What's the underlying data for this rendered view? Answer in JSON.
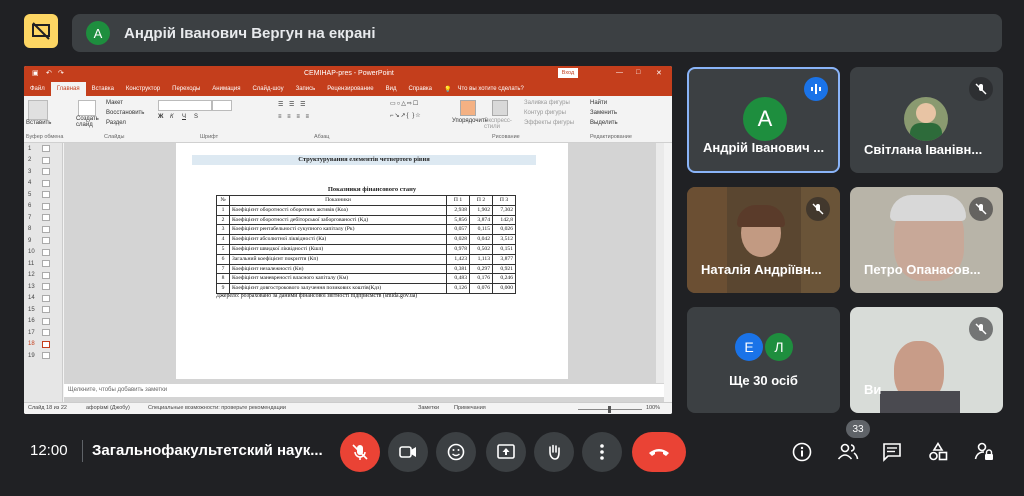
{
  "banner": {
    "presenter_initial": "А",
    "presenter_text": "Андрій Іванович Вергун на екрані"
  },
  "powerpoint": {
    "title": "СЕМІНАР-pres - PowerPoint",
    "login": "Вход",
    "tabs": [
      "Файл",
      "Главная",
      "Вставка",
      "Конструктор",
      "Переходы",
      "Анимация",
      "Слайд-шоу",
      "Запись",
      "Рецензирование",
      "Вид",
      "Справка"
    ],
    "tell_me": "Что вы хотите сделать?",
    "ribbon": {
      "paste": "Вставить",
      "create_slide": "Создать слайд",
      "layout": "Макет",
      "restore": "Восстановить",
      "section": "Раздел",
      "arrange": "Упорядочить",
      "quick_styles": "Экспресс-стили",
      "fill": "Заливка фигуры",
      "outline": "Контур фигуры",
      "effects": "Эффекты фигуры",
      "find": "Найти",
      "replace": "Заменить",
      "select": "Выделить",
      "group_clipboard": "Буфер обмена",
      "group_slides": "Слайды",
      "group_font": "Шрифт",
      "group_paragraph": "Абзац",
      "group_drawing": "Рисование",
      "group_editing": "Редактирование"
    },
    "thumb_numbers": [
      "1",
      "2",
      "3",
      "4",
      "5",
      "6",
      "7",
      "8",
      "9",
      "10",
      "11",
      "12",
      "13",
      "14",
      "15",
      "16",
      "17",
      "18",
      "19"
    ],
    "notes_placeholder": "Щелкните, чтобы добавить заметки",
    "status": {
      "slide": "Слайд 18 из 22",
      "author": "афорізмі (Джобу)",
      "accessibility": "Специальные возможности: проверьте рекомендации",
      "notes": "Заметки",
      "comments": "Примечания",
      "zoom": "100%"
    },
    "slide": {
      "heading": "Структурування елементів четвертого рівня",
      "table_title": "Показники фінансового стану",
      "headers": [
        "№",
        "Показники",
        "П 1",
        "П 2",
        "П 3"
      ],
      "rows": [
        [
          "1",
          "Коефіцієнт оборотності оборотних активів (Коа)",
          "2,938",
          "1,902",
          "7,302"
        ],
        [
          "2",
          "Коефіцієнт оборотності дебіторської заборгованості (Кд)",
          "5,856",
          "3,874",
          "142,8"
        ],
        [
          "3",
          "Коефіцієнт рентабельності сукупного капіталу (Рк)",
          "0,057",
          "0,115",
          "0,026"
        ],
        [
          "4",
          "Коефіцієнт абсолютної ліквідності (Ка)",
          "0,028",
          "0,042",
          "3,512"
        ],
        [
          "5",
          "Коефіцієнт швидкої ліквідності (Кшл)",
          "0,978",
          "0,502",
          "0,151"
        ],
        [
          "6",
          "Загальний коефіцієнт покриття (Кп)",
          "1,423",
          "1,113",
          "3,877"
        ],
        [
          "7",
          "Коефіцієнт незалежності (Кн)",
          "0,381",
          "0,297",
          "0,921"
        ],
        [
          "8",
          "Коефіцієнт маневреності власного капіталу (Км)",
          "0,483",
          "0,176",
          "0,246"
        ],
        [
          "9",
          "Коефіцієнт довгострокового залучення позикових коштів(Кдз)",
          "0,126",
          "0,076",
          "0,000"
        ]
      ],
      "source": "Джерело: розраховано за даними фінансової звітності підприємств (smida.gov.ua)"
    }
  },
  "participants": [
    {
      "name": "Андрій Іванович ...",
      "initial": "А",
      "speaking": true
    },
    {
      "name": "Світлана Іванівн..."
    },
    {
      "name": "Наталія Андріївн..."
    },
    {
      "name": "Петро Опанасов..."
    },
    {
      "name": "Ще 30 осіб",
      "initials": [
        "Е",
        "Л"
      ]
    },
    {
      "name": "Ви"
    }
  ],
  "bottom": {
    "time": "12:00",
    "meeting": "Загальнофакультетский наук...",
    "people_count": "33"
  },
  "colors": {
    "bg": "#202124",
    "tile": "#3c4043",
    "red": "#ea4335",
    "accent_blue": "#8ab4f8",
    "ppt_red": "#c43e1c"
  }
}
